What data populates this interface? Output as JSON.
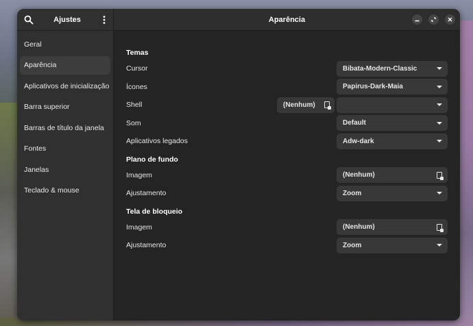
{
  "sidebar": {
    "title": "Ajustes",
    "items": [
      {
        "label": "Geral"
      },
      {
        "label": "Aparência"
      },
      {
        "label": "Aplicativos de inicialização"
      },
      {
        "label": "Barra superior"
      },
      {
        "label": "Barras de título da janela"
      },
      {
        "label": "Fontes"
      },
      {
        "label": "Janelas"
      },
      {
        "label": "Teclado & mouse"
      }
    ],
    "active_index": 1
  },
  "header": {
    "title": "Aparência"
  },
  "sections": {
    "temas": {
      "title": "Temas",
      "cursor": {
        "label": "Cursor",
        "value": "Bibata-Modern-Classic"
      },
      "icones": {
        "label": "Ícones",
        "value": "Papirus-Dark-Maia"
      },
      "shell": {
        "label": "Shell",
        "file_value": "(Nenhum)",
        "value": ""
      },
      "som": {
        "label": "Som",
        "value": "Default"
      },
      "legados": {
        "label": "Aplicativos legados",
        "value": "Adw-dark"
      }
    },
    "plano_de_fundo": {
      "title": "Plano de fundo",
      "imagem": {
        "label": "Imagem",
        "value": "(Nenhum)"
      },
      "ajustamento": {
        "label": "Ajustamento",
        "value": "Zoom"
      }
    },
    "tela_de_bloqueio": {
      "title": "Tela de bloqueio",
      "imagem": {
        "label": "Imagem",
        "value": "(Nenhum)"
      },
      "ajustamento": {
        "label": "Ajustamento",
        "value": "Zoom"
      }
    }
  },
  "icons": {
    "search": "search-icon",
    "menu": "kebab-menu-icon",
    "minimize": "minimize-icon",
    "maximize": "maximize-icon",
    "close": "close-icon",
    "dropdown": "chevron-down-icon",
    "file": "document-icon"
  },
  "colors": {
    "window_bg": "#242424",
    "sidebar_bg": "#303030",
    "control_bg": "#383838"
  }
}
